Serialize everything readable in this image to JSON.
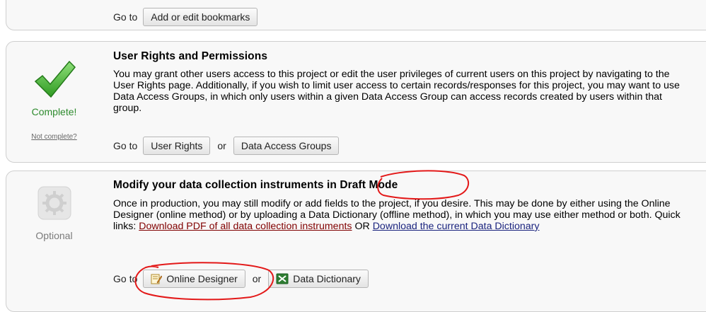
{
  "bookmarks": {
    "goto_label": "Go to",
    "button": "Add or edit bookmarks"
  },
  "user_rights": {
    "status": "Complete!",
    "not_complete": "Not complete?",
    "title": "User Rights and Permissions",
    "description": "You may grant other users access to this project or edit the user privileges of current users on this project by navigating to the User Rights page. Additionally, if you wish to limit user access to certain records/responses for this project, you may want to use Data Access Groups, in which only users within a given Data Access Group can access records created by users within that group.",
    "goto_label": "Go to",
    "or_label": "or",
    "button_user_rights": "User Rights",
    "button_dag": "Data Access Groups"
  },
  "draft_mode": {
    "status": "Optional",
    "title_prefix": "Modify your data collection instruments i",
    "title_highlight": "n Draft Mode",
    "description": "Once in production, you may still modify or add fields to the project, if you desire. This may be done by either using the Online Designer (online method) or by uploading a Data Dictionary (offline method), in which you may use either method or both. Quick links: ",
    "link_pdf": "Download PDF of all data collection instruments",
    "link_or": " OR ",
    "link_dictionary": "Download the current Data Dictionary",
    "goto_label_a": "Go",
    "goto_label_b": "to",
    "or_label": "or",
    "button_online_designer": "Online Designer",
    "button_data_dictionary": "Data Dictionary"
  },
  "colors": {
    "complete_green": "#2e8b2e",
    "link_red": "#800000",
    "annotation_red": "#e31919"
  }
}
